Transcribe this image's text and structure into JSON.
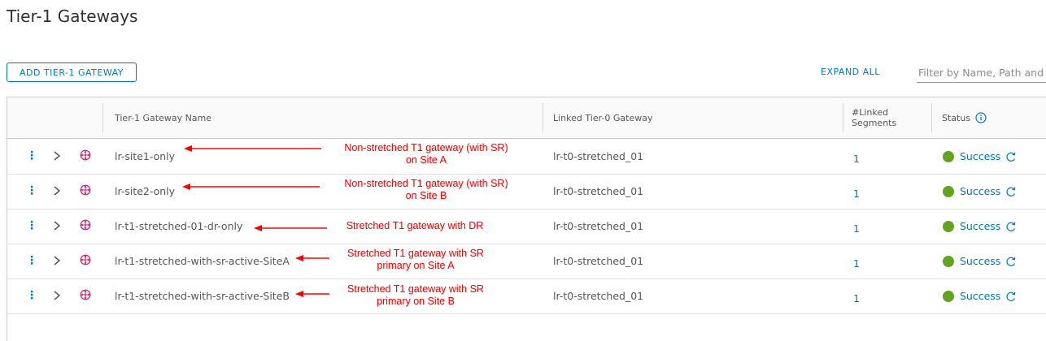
{
  "page": {
    "title": "Tier-1 Gateways"
  },
  "toolbar": {
    "add_label": "ADD TIER-1 GATEWAY",
    "expand_all_label": "EXPAND ALL",
    "filter_placeholder": "Filter by Name, Path and more"
  },
  "table": {
    "columns": {
      "name": "Tier-1 Gateway Name",
      "linked_t0": "Linked Tier-0 Gateway",
      "linked_segments_line1": "#Linked",
      "linked_segments_line2": "Segments",
      "status": "Status"
    },
    "rows": [
      {
        "name": "lr-site1-only",
        "linked_t0": "lr-t0-stretched_01",
        "segments": "1",
        "status": "Success"
      },
      {
        "name": "lr-site2-only",
        "linked_t0": "lr-t0-stretched_01",
        "segments": "1",
        "status": "Success"
      },
      {
        "name": "lr-t1-stretched-01-dr-only",
        "linked_t0": "lr-t0-stretched_01",
        "segments": "1",
        "status": "Success"
      },
      {
        "name": "lr-t1-stretched-with-sr-active-SiteA",
        "linked_t0": "lr-t0-stretched_01",
        "segments": "1",
        "status": "Success"
      },
      {
        "name": "lr-t1-stretched-with-sr-active-SiteB",
        "linked_t0": "lr-t0-stretched_01",
        "segments": "1",
        "status": "Success"
      }
    ]
  },
  "annotations": [
    {
      "line1": "Non-stretched T1 gateway (with SR)",
      "line2": "on Site A"
    },
    {
      "line1": "Non-stretched T1 gateway (with SR)",
      "line2": "on Site B"
    },
    {
      "line1": "Stretched T1 gateway with DR",
      "line2": ""
    },
    {
      "line1": "Stretched T1 gateway with SR",
      "line2": "primary on Site A"
    },
    {
      "line1": "Stretched T1 gateway with SR",
      "line2": "primary on Site B"
    }
  ],
  "colors": {
    "accent": "#0079b8",
    "success": "#62a420",
    "annotation": "#ff0000",
    "gateway_icon": "#c7216b"
  },
  "icons": {
    "row_menu": "kebab-vertical-icon",
    "expand": "chevron-right-icon",
    "gateway": "tier1-gateway-icon",
    "status_refresh": "refresh-icon",
    "status_info": "info-circle-icon"
  }
}
